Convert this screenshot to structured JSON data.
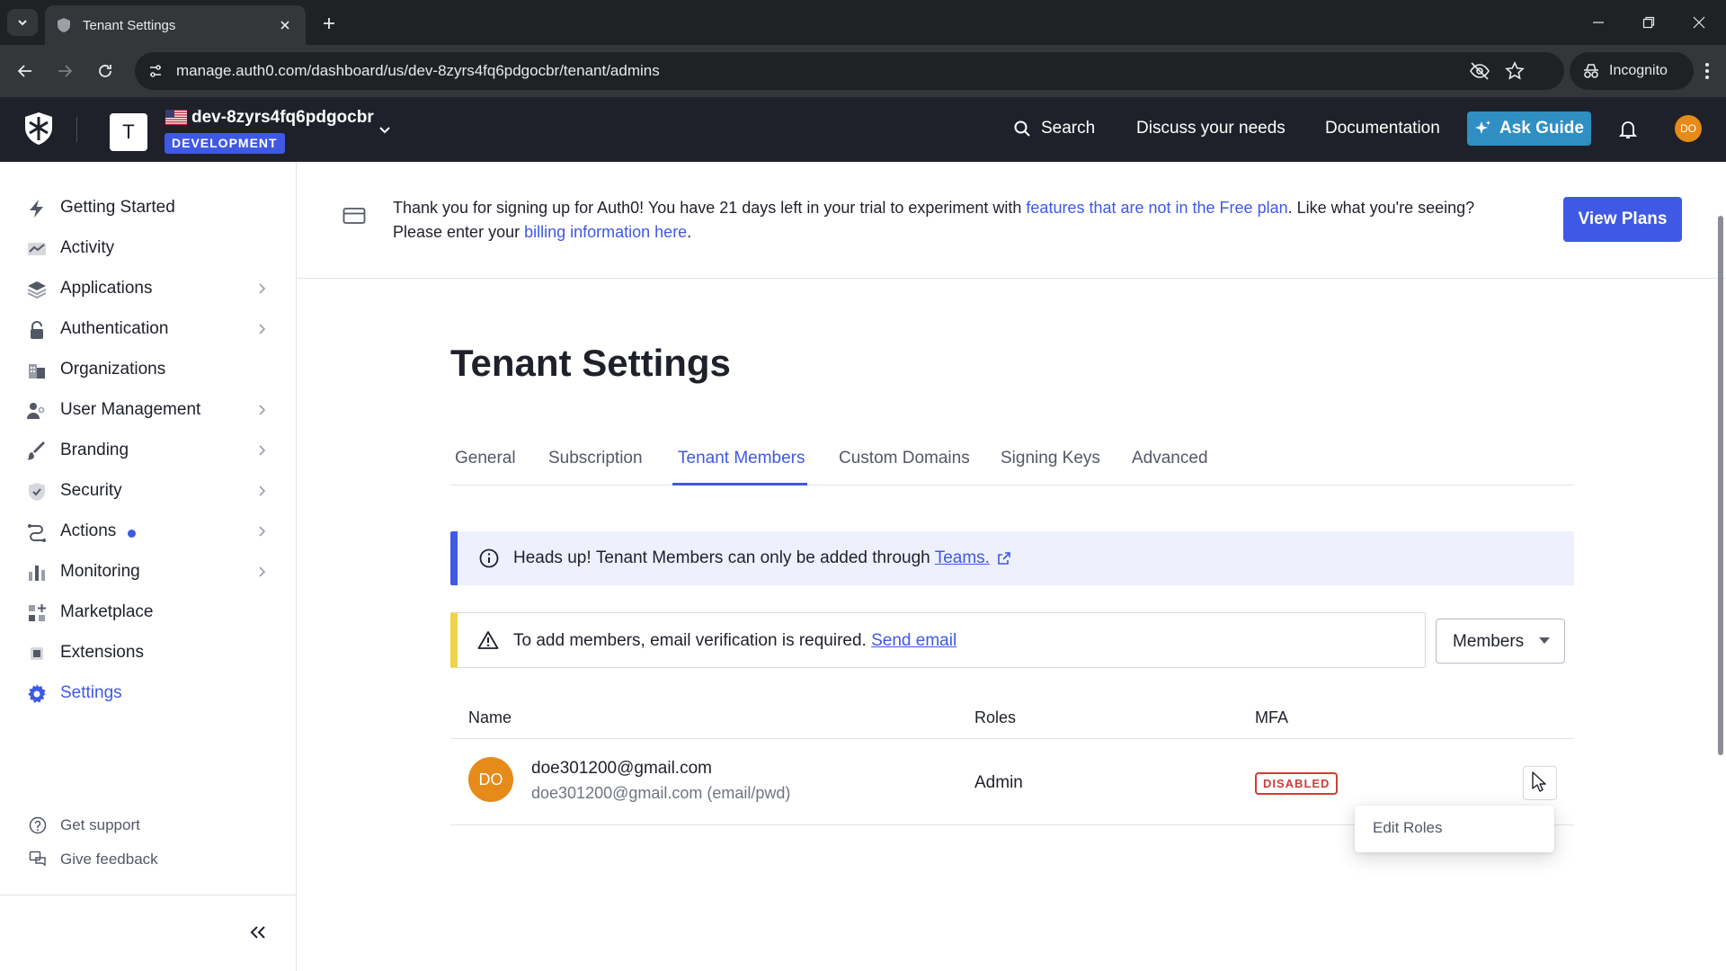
{
  "browser": {
    "tab_title": "Tenant Settings",
    "url": "manage.auth0.com/dashboard/us/dev-8zyrs4fq6pdgocbr/tenant/admins",
    "incognito_label": "Incognito"
  },
  "header": {
    "tenant_initial": "T",
    "tenant_name": "dev-8zyrs4fq6pdgocbr",
    "environment": "DEVELOPMENT",
    "search_label": "Search",
    "discuss_label": "Discuss your needs",
    "docs_label": "Documentation",
    "ask_guide_label": "Ask Guide",
    "user_initials": "DO"
  },
  "sidebar": {
    "items": [
      {
        "label": "Getting Started",
        "icon": "bolt-icon"
      },
      {
        "label": "Activity",
        "icon": "activity-icon"
      },
      {
        "label": "Applications",
        "icon": "layers-icon"
      },
      {
        "label": "Authentication",
        "icon": "lock-icon"
      },
      {
        "label": "Organizations",
        "icon": "building-icon"
      },
      {
        "label": "User Management",
        "icon": "users-icon"
      },
      {
        "label": "Branding",
        "icon": "brush-icon"
      },
      {
        "label": "Security",
        "icon": "shield-icon"
      },
      {
        "label": "Actions",
        "icon": "flow-icon"
      },
      {
        "label": "Monitoring",
        "icon": "bar-chart-icon"
      },
      {
        "label": "Marketplace",
        "icon": "grid-plus-icon"
      },
      {
        "label": "Extensions",
        "icon": "puzzle-icon"
      },
      {
        "label": "Settings",
        "icon": "gear-icon"
      }
    ],
    "get_support": "Get support",
    "give_feedback": "Give feedback"
  },
  "trial_banner": {
    "text_1": "Thank you for signing up for Auth0! You have 21 days left in your trial to experiment with ",
    "link_1": "features that are not in the Free plan",
    "text_2": ". Like what you're seeing? Please enter your ",
    "link_2": "billing information here",
    "text_3": ".",
    "button": "View Plans"
  },
  "page": {
    "title": "Tenant Settings",
    "tabs": [
      "General",
      "Subscription",
      "Tenant Members",
      "Custom Domains",
      "Signing Keys",
      "Advanced"
    ],
    "active_tab": "Tenant Members"
  },
  "notice": {
    "bold": "Heads up!",
    "text": "Tenant Members can only be added through",
    "link": "Teams."
  },
  "warning": {
    "text": "To add members, email verification is required.",
    "link": "Send email"
  },
  "members_filter": {
    "value": "Members"
  },
  "table": {
    "columns": [
      "Name",
      "Roles",
      "MFA"
    ],
    "rows": [
      {
        "initials": "DO",
        "email": "doe301200@gmail.com",
        "connection": "doe301200@gmail.com (email/pwd)",
        "role": "Admin",
        "mfa": "DISABLED"
      }
    ]
  },
  "row_menu": {
    "items": [
      "Edit Roles"
    ]
  },
  "colors": {
    "accent": "#3f59e4",
    "header_bg": "#1e212a",
    "avatar": "#e68a19",
    "danger": "#d03c38",
    "warning_bar": "#eed34a",
    "ask_guide": "#2f8ec2"
  }
}
